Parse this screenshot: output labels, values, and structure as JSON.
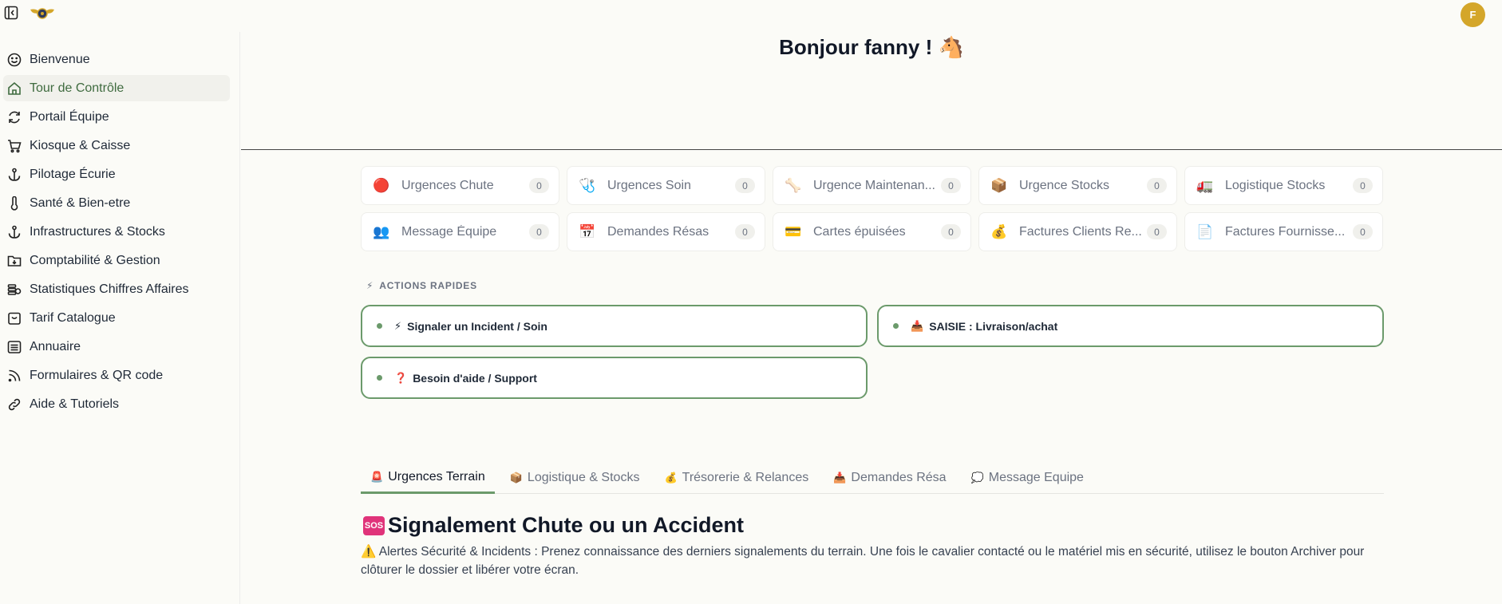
{
  "topbar": {
    "user_initial": "F"
  },
  "sidebar": {
    "items": [
      {
        "label": "Bienvenue",
        "icon": "smile-icon"
      },
      {
        "label": "Tour de Contrôle",
        "icon": "home-icon"
      },
      {
        "label": "Portail Équipe",
        "icon": "refresh-icon"
      },
      {
        "label": "Kiosque & Caisse",
        "icon": "cart-icon"
      },
      {
        "label": "Pilotage Écurie",
        "icon": "anchor-icon"
      },
      {
        "label": "Santé & Bien-etre",
        "icon": "thermometer-icon"
      },
      {
        "label": "Infrastructures & Stocks",
        "icon": "anchor-icon"
      },
      {
        "label": "Comptabilité & Gestion",
        "icon": "folder-download-icon"
      },
      {
        "label": "Statistiques Chiffres Affaires",
        "icon": "coins-icon"
      },
      {
        "label": "Tarif Catalogue",
        "icon": "calendar-icon"
      },
      {
        "label": "Annuaire",
        "icon": "list-icon"
      },
      {
        "label": "Formulaires & QR code",
        "icon": "rss-icon"
      },
      {
        "label": "Aide & Tutoriels",
        "icon": "link-icon"
      }
    ],
    "active_index": 1
  },
  "greeting": "Bonjour fanny ! 🐴",
  "counters": [
    {
      "label": "Urgences Chute",
      "count": "0",
      "icon": "🔴"
    },
    {
      "label": "Urgences Soin",
      "count": "0",
      "icon": "🩺"
    },
    {
      "label": "Urgence Maintenan...",
      "count": "0",
      "icon": "🦴"
    },
    {
      "label": "Urgence Stocks",
      "count": "0",
      "icon": "📦"
    },
    {
      "label": "Logistique Stocks",
      "count": "0",
      "icon": "🚛"
    },
    {
      "label": "Message Équipe",
      "count": "0",
      "icon": "👥"
    },
    {
      "label": "Demandes Résas",
      "count": "0",
      "icon": "📅"
    },
    {
      "label": "Cartes épuisées",
      "count": "0",
      "icon": "💳"
    },
    {
      "label": "Factures Clients Re...",
      "count": "0",
      "icon": "💰"
    },
    {
      "label": "Factures Fournisse...",
      "count": "0",
      "icon": "📄"
    }
  ],
  "quick_actions": {
    "title": "ACTIONS RAPIDES",
    "icon": "⚡",
    "items": [
      {
        "label": "Signaler un Incident / Soin",
        "icon": "⚡"
      },
      {
        "label": "SAISIE : Livraison/achat",
        "icon": "📥"
      },
      {
        "label": "Besoin d'aide / Support",
        "icon": "❓"
      }
    ]
  },
  "tabs": [
    {
      "label": "Urgences Terrain",
      "icon": "🚨"
    },
    {
      "label": "Logistique & Stocks",
      "icon": "📦"
    },
    {
      "label": "Trésorerie & Relances",
      "icon": "💰"
    },
    {
      "label": "Demandes Résa",
      "icon": "📥"
    },
    {
      "label": "Message Equipe",
      "icon": "💭"
    }
  ],
  "active_tab": 0,
  "content": {
    "badge": "SOS",
    "title": "Signalement Chute ou un Accident",
    "description": "⚠️ Alertes Sécurité & Incidents : Prenez connaissance des derniers signalements du terrain. Une fois le cavalier contacté ou le matériel mis en sécurité, utilisez le bouton Archiver pour clôturer le dossier et libérer votre écran."
  },
  "colors": {
    "accent": "#6b9a6b",
    "avatar": "#d4a62a",
    "active_nav_text": "#3f6b3f",
    "sos": "#e0337a"
  }
}
